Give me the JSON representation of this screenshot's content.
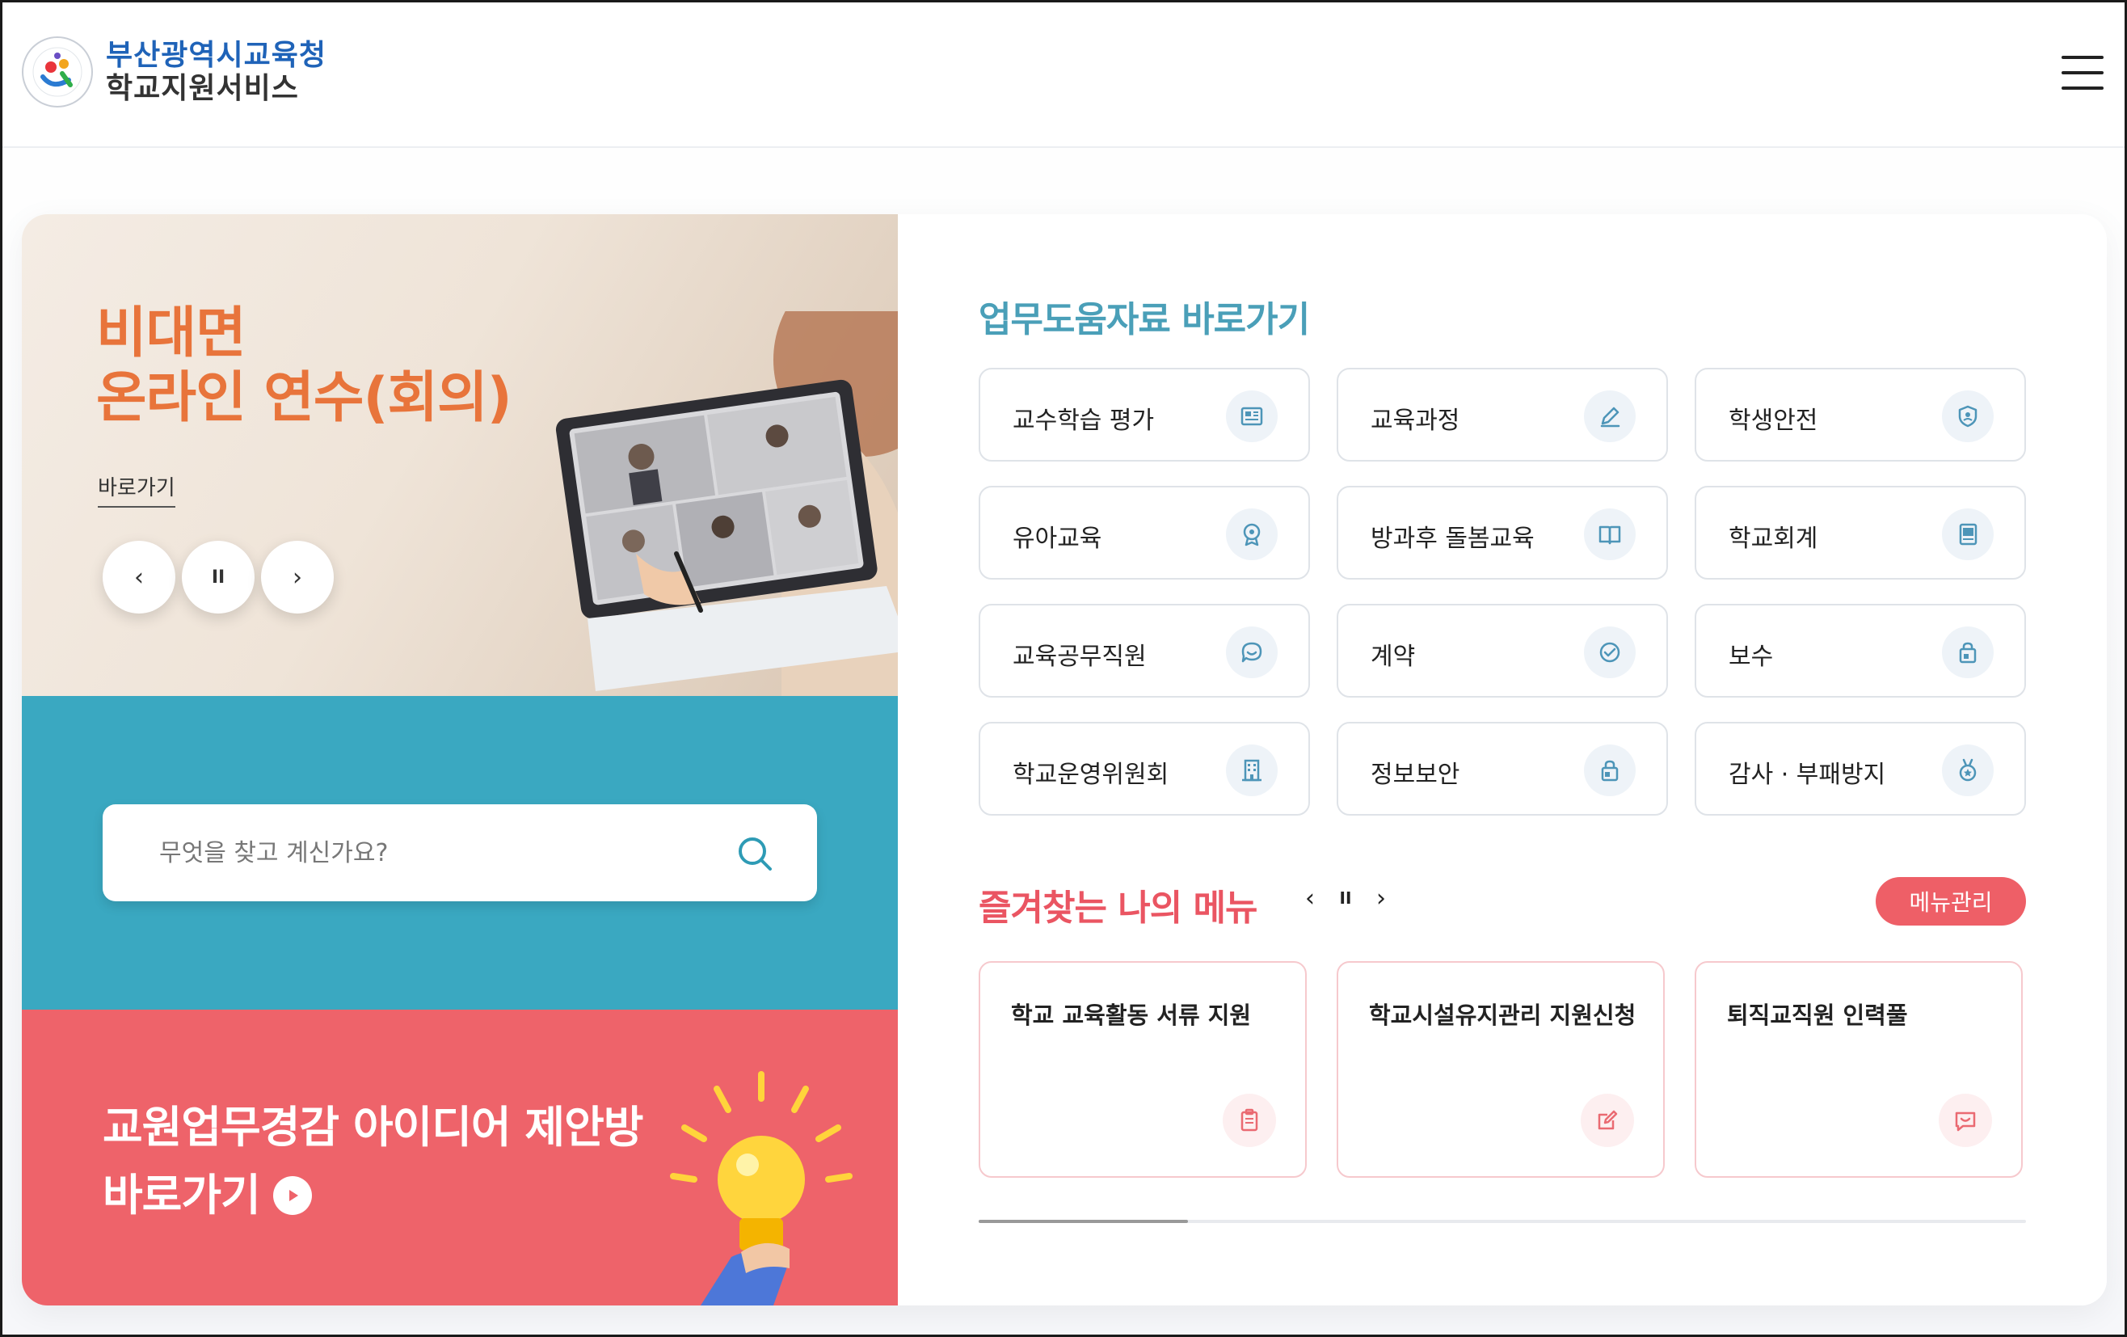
{
  "header": {
    "logo_line1": "부산광역시교육청",
    "logo_line2": "학교지원서비스"
  },
  "banner": {
    "title_line1": "비대면",
    "title_line2": "온라인 연수(회의)",
    "link_label": "바로가기",
    "prev_symbol": "‹",
    "pause_symbol": "II",
    "next_symbol": "›"
  },
  "search": {
    "placeholder": "무엇을 찾고 계신가요?"
  },
  "idea": {
    "line1": "교원업무경감 아이디어 제안방",
    "line2": "바로가기"
  },
  "shortcuts": {
    "title": "업무도움자료 바로가기",
    "items": [
      {
        "label": "교수학습 평가",
        "icon": "newspaper-icon"
      },
      {
        "label": "교육과정",
        "icon": "pencil-icon"
      },
      {
        "label": "학생안전",
        "icon": "shield-icon"
      },
      {
        "label": "유아교육",
        "icon": "badge-icon"
      },
      {
        "label": "방과후 돌봄교육",
        "icon": "book-icon"
      },
      {
        "label": "학교회계",
        "icon": "ledger-icon"
      },
      {
        "label": "교육공무직원",
        "icon": "chat-icon"
      },
      {
        "label": "계약",
        "icon": "check-circle-icon"
      },
      {
        "label": "보수",
        "icon": "bag-icon"
      },
      {
        "label": "학교운영위원회",
        "icon": "building-icon"
      },
      {
        "label": "정보보안",
        "icon": "lock-icon"
      },
      {
        "label": "감사 · 부패방지",
        "icon": "medal-icon"
      }
    ]
  },
  "favorites": {
    "title": "즐겨찾는 나의 메뉴",
    "prev_symbol": "‹",
    "pause_symbol": "II",
    "next_symbol": "›",
    "manage_label": "메뉴관리",
    "progress": 0.2,
    "items": [
      {
        "label": "학교 교육활동 서류 지원",
        "icon": "clipboard-icon"
      },
      {
        "label": "학교시설유지관리 지원신청",
        "icon": "edit-icon"
      },
      {
        "label": "퇴직교직원 인력풀",
        "icon": "message-icon"
      }
    ]
  },
  "colors": {
    "accent_blue": "#3aa8c1",
    "accent_red": "#ee636a",
    "banner_orange": "#e8743b",
    "shortcut_title": "#4a9fb8",
    "favorites_title": "#ea5562"
  }
}
